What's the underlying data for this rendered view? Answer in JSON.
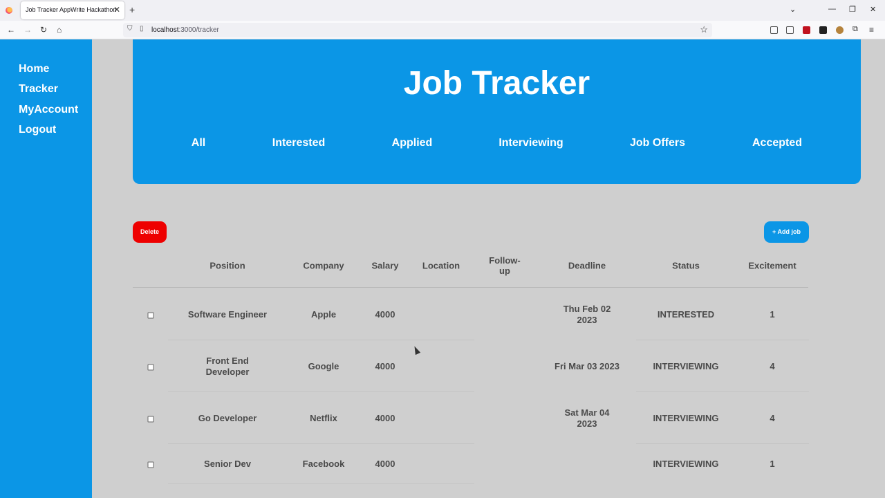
{
  "browser": {
    "tab_title": "Job Tracker AppWrite Hackathon",
    "url_host": "localhost",
    "url_path": ":3000/tracker"
  },
  "sidebar": {
    "items": [
      {
        "label": "Home"
      },
      {
        "label": "Tracker"
      },
      {
        "label": "MyAccount"
      },
      {
        "label": "Logout"
      }
    ]
  },
  "hero": {
    "title": "Job Tracker",
    "filters": [
      "All",
      "Interested",
      "Applied",
      "Interviewing",
      "Job Offers",
      "Accepted"
    ]
  },
  "actions": {
    "delete_label": "Delete",
    "add_label": "+ Add job"
  },
  "table": {
    "columns": [
      "Position",
      "Company",
      "Salary",
      "Location",
      "Follow-up",
      "Deadline",
      "Status",
      "Excitement"
    ],
    "rows": [
      {
        "position": "Software Engineer",
        "company": "Apple",
        "salary": "4000",
        "location": "",
        "followup": "",
        "deadline": "Thu Feb 02 2023",
        "status": "INTERESTED",
        "excitement": "1"
      },
      {
        "position": "Front End Developer",
        "company": "Google",
        "salary": "4000",
        "location": "",
        "followup": "",
        "deadline": "Fri Mar 03 2023",
        "status": "INTERVIEWING",
        "excitement": "4"
      },
      {
        "position": "Go Developer",
        "company": "Netflix",
        "salary": "4000",
        "location": "",
        "followup": "",
        "deadline": "Sat Mar 04 2023",
        "status": "INTERVIEWING",
        "excitement": "4"
      },
      {
        "position": "Senior Dev",
        "company": "Facebook",
        "salary": "4000",
        "location": "",
        "followup": "",
        "deadline": "",
        "status": "INTERVIEWING",
        "excitement": "1"
      }
    ]
  },
  "colors": {
    "brand_blue": "#0b96e6",
    "delete_red": "#ee0000",
    "page_bg": "#cfcfcf"
  }
}
